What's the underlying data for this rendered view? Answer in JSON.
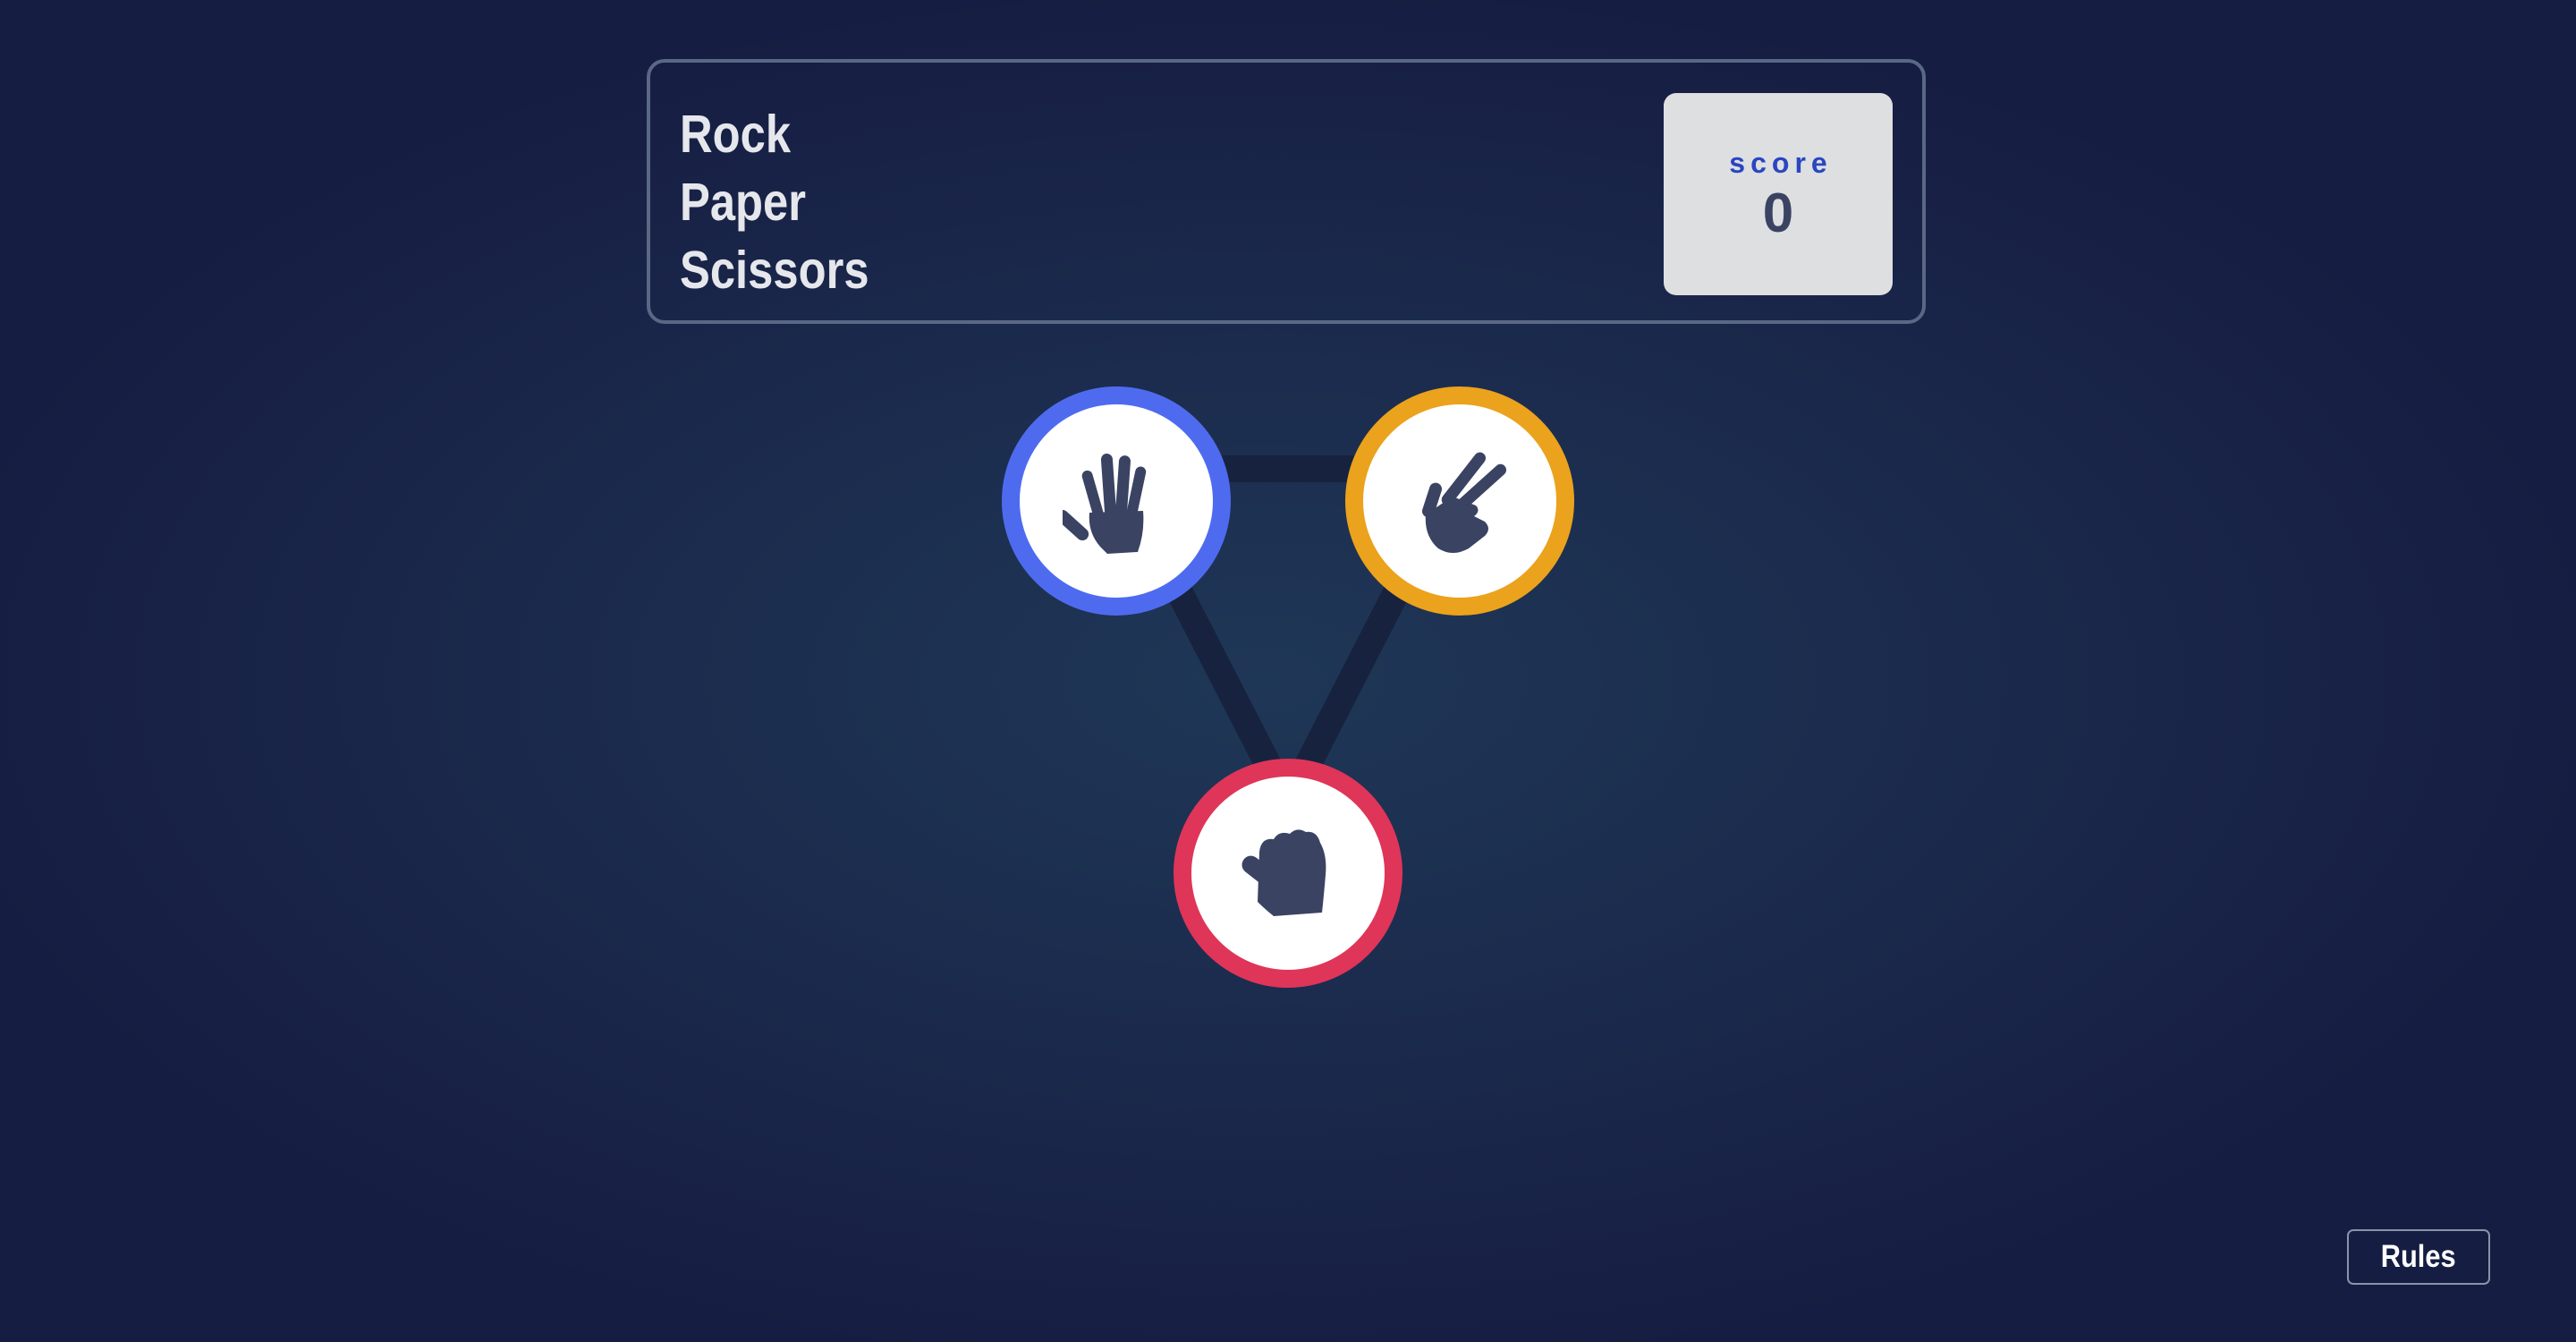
{
  "header": {
    "title_lines": [
      "Rock",
      "Paper",
      "Scissors"
    ],
    "score": {
      "label": "score",
      "value": "0"
    }
  },
  "choices": [
    {
      "name": "paper",
      "icon": "hand-open-icon",
      "ring_color": "#4e6bf0"
    },
    {
      "name": "scissors",
      "icon": "hand-scissors-icon",
      "ring_color": "#eba21c"
    },
    {
      "name": "rock",
      "icon": "hand-fist-icon",
      "ring_color": "#df3558"
    }
  ],
  "colors": {
    "icon": "#3b4363",
    "score_label": "#2a46c0",
    "header_border": "#5a6886",
    "triangle": "#17233e"
  },
  "footer": {
    "rules_label": "Rules"
  }
}
